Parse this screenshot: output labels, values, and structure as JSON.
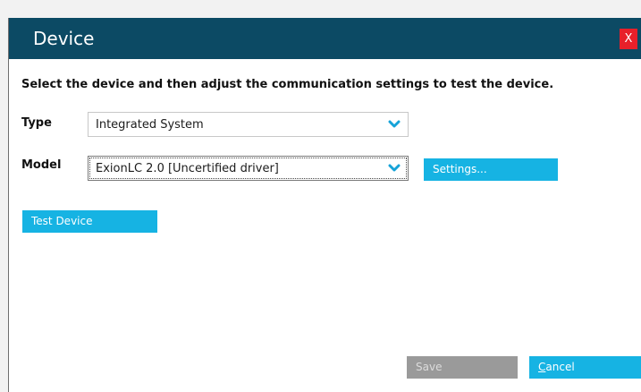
{
  "dialog": {
    "title": "Device",
    "close_label": "X"
  },
  "instruction": "Select the device and then adjust the communication settings to test the device.",
  "type_field": {
    "label": "Type",
    "value": "Integrated System"
  },
  "model_field": {
    "label": "Model",
    "value": "ExionLC 2.0 [Uncertified driver]"
  },
  "buttons": {
    "settings": "Settings...",
    "test_device": "Test Device",
    "save": "Save",
    "cancel": "Cancel"
  },
  "colors": {
    "titlebar": "#0c4a64",
    "button": "#16b3e3",
    "button_disabled": "#9a9a9a",
    "close": "#e8202a"
  }
}
